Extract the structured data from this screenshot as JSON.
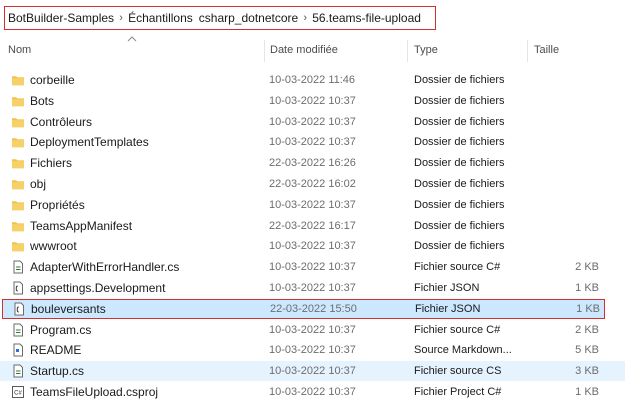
{
  "breadcrumb": {
    "items": [
      "BotBuilder-Samples",
      "Échantillons",
      "csharp_dotnetcore",
      "56.teams-file-upload"
    ]
  },
  "columns": {
    "name": "Nom",
    "date": "Date modifiée",
    "type": "Type",
    "size": "Taille"
  },
  "sort": {
    "column": "Nom",
    "direction": "ascending"
  },
  "files": [
    {
      "name": "corbeille",
      "date": "10-03-2022 11:46",
      "type": "Dossier de fichiers",
      "size": "",
      "icon": "folder-icon"
    },
    {
      "name": "Bots",
      "date": "10-03-2022 10:37",
      "type": "Dossier de fichiers",
      "size": "",
      "icon": "folder-icon"
    },
    {
      "name": "Contrôleurs",
      "date": "10-03-2022 10:37",
      "type": "Dossier de fichiers",
      "size": "",
      "icon": "folder-icon"
    },
    {
      "name": "DeploymentTemplates",
      "date": "10-03-2022 10:37",
      "type": "Dossier de fichiers",
      "size": "",
      "icon": "folder-icon"
    },
    {
      "name": "Fichiers",
      "date": "22-03-2022 16:26",
      "type": "Dossier de fichiers",
      "size": "",
      "icon": "folder-icon"
    },
    {
      "name": "obj",
      "date": "22-03-2022 16:02",
      "type": "Dossier de fichiers",
      "size": "",
      "icon": "folder-icon"
    },
    {
      "name": "Propriétés",
      "date": "10-03-2022 10:37",
      "type": "Dossier de fichiers",
      "size": "",
      "icon": "folder-icon"
    },
    {
      "name": "TeamsAppManifest",
      "date": "22-03-2022 16:17",
      "type": "Dossier de fichiers",
      "size": "",
      "icon": "folder-icon"
    },
    {
      "name": "wwwroot",
      "date": "10-03-2022 10:37",
      "type": "Dossier de fichiers",
      "size": "",
      "icon": "folder-icon"
    },
    {
      "name": "AdapterWithErrorHandler.cs",
      "date": "10-03-2022 10:37",
      "type": "Fichier source C#",
      "size": "2 KB",
      "icon": "csharp-file-icon"
    },
    {
      "name": "appsettings.Development",
      "date": "10-03-2022 10:37",
      "type": "Fichier JSON",
      "size": "1 KB",
      "icon": "json-file-icon"
    },
    {
      "name": "bouleversants",
      "date": "22-03-2022 15:50",
      "type": "Fichier JSON",
      "size": "1 KB",
      "icon": "json-file-icon",
      "state": "selected"
    },
    {
      "name": "Program.cs",
      "date": "10-03-2022 10:37",
      "type": "Fichier source C#",
      "size": "2 KB",
      "icon": "csharp-file-icon"
    },
    {
      "name": "README",
      "date": "10-03-2022 10:37",
      "type": "Source Markdown...",
      "size": "5 KB",
      "icon": "markdown-file-icon"
    },
    {
      "name": "Startup.cs",
      "date": "10-03-2022 10:37",
      "type": "Fichier source CS",
      "size": "3 KB",
      "icon": "csharp-file-icon",
      "state": "hover"
    },
    {
      "name": "TeamsFileUpload.csproj",
      "date": "10-03-2022 10:37",
      "type": "Fichier Project C#",
      "size": "1 KB",
      "icon": "csproj-file-icon"
    }
  ],
  "colors": {
    "folder": "#f0c24b",
    "selection_bg": "#cce8ff",
    "hover_bg": "#e5f3ff",
    "highlight_border": "#d32f2f"
  }
}
